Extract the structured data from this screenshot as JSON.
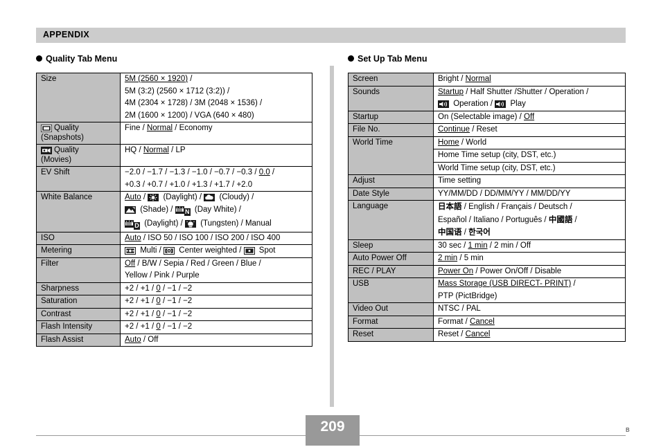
{
  "document": {
    "header_title": "APPENDIX",
    "page_number": "209",
    "corner_mark": "B",
    "accent_gray": "#c0c0c0",
    "header_band_gray": "#cccccc",
    "footer_gray": "#999999"
  },
  "left_section": {
    "heading": "Quality Tab Menu",
    "rows": [
      {
        "label_lines": [
          "Size"
        ],
        "label_icon": null,
        "value_lines": [
          [
            {
              "t": "5M (2560 × 1920)",
              "u": true
            },
            {
              "t": " /"
            }
          ],
          [
            {
              "t": "5M (3:2) (2560 × 1712 (3:2)) /"
            }
          ],
          [
            {
              "t": "4M (2304 × 1728) / 3M (2048 × 1536) /"
            }
          ],
          [
            {
              "t": "2M (1600 × 1200) / VGA (640 × 480)"
            }
          ]
        ]
      },
      {
        "label_lines": [
          "Quality",
          "(Snapshots)"
        ],
        "label_icon": "snapshot-quality-icon",
        "value_lines": [
          [
            {
              "t": "Fine / "
            },
            {
              "t": "Normal",
              "u": true
            },
            {
              "t": " / Economy"
            }
          ]
        ]
      },
      {
        "label_lines": [
          "Quality",
          "(Movies)"
        ],
        "label_icon": "movie-quality-icon",
        "value_lines": [
          [
            {
              "t": "HQ / "
            },
            {
              "t": "Normal",
              "u": true
            },
            {
              "t": " / LP"
            }
          ]
        ]
      },
      {
        "label_lines": [
          "EV Shift"
        ],
        "label_icon": null,
        "value_lines": [
          [
            {
              "t": "−2.0 / −1.7 / −1.3 / −1.0 / −0.7 / −0.3 / "
            },
            {
              "t": "0.0",
              "u": true
            },
            {
              "t": " /"
            }
          ],
          [
            {
              "t": "+0.3 / +0.7 / +1.0 / +1.3 / +1.7 / +2.0"
            }
          ]
        ]
      },
      {
        "label_lines": [
          "White Balance"
        ],
        "label_icon": null,
        "value_lines": [
          [
            {
              "t": "Auto",
              "u": true
            },
            {
              "t": " / "
            },
            {
              "icon": "daylight-sun-icon"
            },
            {
              "t": " (Daylight) / "
            },
            {
              "icon": "cloudy-icon"
            },
            {
              "t": " (Cloudy) /"
            }
          ],
          [
            {
              "icon": "shade-icon"
            },
            {
              "t": " (Shade) / "
            },
            {
              "icon": "day-white-fluorescent-icon"
            },
            {
              "t": " (Day White) /"
            }
          ],
          [
            {
              "icon": "daylight-fluorescent-icon"
            },
            {
              "t": " (Daylight) / "
            },
            {
              "icon": "tungsten-icon"
            },
            {
              "t": " (Tungsten) / Manual"
            }
          ]
        ]
      },
      {
        "label_lines": [
          "ISO"
        ],
        "label_icon": null,
        "value_lines": [
          [
            {
              "t": "Auto",
              "u": true
            },
            {
              "t": " / ISO 50 / ISO 100 / ISO 200 / ISO 400"
            }
          ]
        ]
      },
      {
        "label_lines": [
          "Metering"
        ],
        "label_icon": null,
        "value_lines": [
          [
            {
              "icon": "metering-multi-icon"
            },
            {
              "t": " Multi / "
            },
            {
              "icon": "metering-center-icon"
            },
            {
              "t": " Center weighted / "
            },
            {
              "icon": "metering-spot-icon"
            },
            {
              "t": " Spot"
            }
          ]
        ]
      },
      {
        "label_lines": [
          "Filter"
        ],
        "label_icon": null,
        "value_lines": [
          [
            {
              "t": "Off",
              "u": true
            },
            {
              "t": " / B/W / Sepia / Red / Green / Blue /"
            }
          ],
          [
            {
              "t": "Yellow / Pink / Purple"
            }
          ]
        ]
      },
      {
        "label_lines": [
          "Sharpness"
        ],
        "label_icon": null,
        "value_lines": [
          [
            {
              "t": "+2 / +1 / "
            },
            {
              "t": "0",
              "u": true
            },
            {
              "t": " / −1 / −2"
            }
          ]
        ]
      },
      {
        "label_lines": [
          "Saturation"
        ],
        "label_icon": null,
        "value_lines": [
          [
            {
              "t": "+2 / +1 / "
            },
            {
              "t": "0",
              "u": true
            },
            {
              "t": " / −1 / −2"
            }
          ]
        ]
      },
      {
        "label_lines": [
          "Contrast"
        ],
        "label_icon": null,
        "value_lines": [
          [
            {
              "t": "+2 / +1 / "
            },
            {
              "t": "0",
              "u": true
            },
            {
              "t": " / −1 / −2"
            }
          ]
        ]
      },
      {
        "label_lines": [
          "Flash Intensity"
        ],
        "label_icon": null,
        "value_lines": [
          [
            {
              "t": "+2 / +1 / "
            },
            {
              "t": "0",
              "u": true
            },
            {
              "t": " / −1 / −2"
            }
          ]
        ]
      },
      {
        "label_lines": [
          "Flash Assist"
        ],
        "label_icon": null,
        "value_lines": [
          [
            {
              "t": "Auto",
              "u": true
            },
            {
              "t": " / Off"
            }
          ]
        ]
      }
    ]
  },
  "right_section": {
    "heading": "Set Up Tab Menu",
    "rows": [
      {
        "label_lines": [
          "Screen"
        ],
        "value_lines": [
          [
            {
              "t": "Bright / "
            },
            {
              "t": "Normal",
              "u": true
            }
          ]
        ]
      },
      {
        "label_lines": [
          "Sounds"
        ],
        "value_lines": [
          [
            {
              "t": "Startup",
              "u": true
            },
            {
              "t": " / Half Shutter /Shutter / Operation /"
            }
          ],
          [
            {
              "icon": "speaker-icon"
            },
            {
              "t": " Operation / "
            },
            {
              "icon": "speaker-icon"
            },
            {
              "t": " Play"
            }
          ]
        ]
      },
      {
        "label_lines": [
          "Startup"
        ],
        "value_lines": [
          [
            {
              "t": "On (Selectable image) / "
            },
            {
              "t": "Off",
              "u": true
            }
          ]
        ]
      },
      {
        "label_lines": [
          "File No."
        ],
        "value_lines": [
          [
            {
              "t": "Continue",
              "u": true
            },
            {
              "t": " / Reset"
            }
          ]
        ]
      },
      {
        "label_lines": [
          "World Time"
        ],
        "split": true,
        "value_lines": [
          [
            {
              "t": "Home",
              "u": true
            },
            {
              "t": " / World"
            }
          ],
          [
            {
              "t": "Home Time setup (city, DST, etc.)"
            }
          ],
          [
            {
              "t": "World Time setup (city, DST, etc.)"
            }
          ]
        ]
      },
      {
        "label_lines": [
          "Adjust"
        ],
        "value_lines": [
          [
            {
              "t": "Time setting"
            }
          ]
        ]
      },
      {
        "label_lines": [
          "Date Style"
        ],
        "value_lines": [
          [
            {
              "t": "YY/MM/DD / DD/MM/YY / MM/DD/YY"
            }
          ]
        ]
      },
      {
        "label_lines": [
          "Language"
        ],
        "value_lines": [
          [
            {
              "t": "日本語",
              "cjk": true
            },
            {
              "t": " / English / Français / Deutsch /"
            }
          ],
          [
            {
              "t": "Español / Italiano / Português / "
            },
            {
              "t": "中國語",
              "cjk": true
            },
            {
              "t": " /"
            }
          ],
          [
            {
              "t": "中国语",
              "cjk": true
            },
            {
              "t": " / "
            },
            {
              "t": "한국어",
              "cjk": true
            }
          ]
        ]
      },
      {
        "label_lines": [
          "Sleep"
        ],
        "value_lines": [
          [
            {
              "t": "30 sec / "
            },
            {
              "t": "1 min",
              "u": true
            },
            {
              "t": " / 2 min / Off"
            }
          ]
        ]
      },
      {
        "label_lines": [
          "Auto Power Off"
        ],
        "value_lines": [
          [
            {
              "t": "2 min",
              "u": true
            },
            {
              "t": " / 5 min"
            }
          ]
        ]
      },
      {
        "label_lines": [
          "REC / PLAY"
        ],
        "value_lines": [
          [
            {
              "t": "Power On",
              "u": true
            },
            {
              "t": " / Power On/Off / Disable"
            }
          ]
        ]
      },
      {
        "label_lines": [
          "USB"
        ],
        "value_lines": [
          [
            {
              "t": "Mass Storage (USB DIRECT- PRINT)",
              "u": true
            },
            {
              "t": " /"
            }
          ],
          [
            {
              "t": "PTP (PictBridge)"
            }
          ]
        ]
      },
      {
        "label_lines": [
          "Video Out"
        ],
        "value_lines": [
          [
            {
              "t": "NTSC / PAL"
            }
          ]
        ]
      },
      {
        "label_lines": [
          "Format"
        ],
        "value_lines": [
          [
            {
              "t": "Format / "
            },
            {
              "t": "Cancel",
              "u": true
            }
          ]
        ]
      },
      {
        "label_lines": [
          "Reset"
        ],
        "value_lines": [
          [
            {
              "t": "Reset / "
            },
            {
              "t": "Cancel",
              "u": true
            }
          ]
        ]
      }
    ]
  }
}
